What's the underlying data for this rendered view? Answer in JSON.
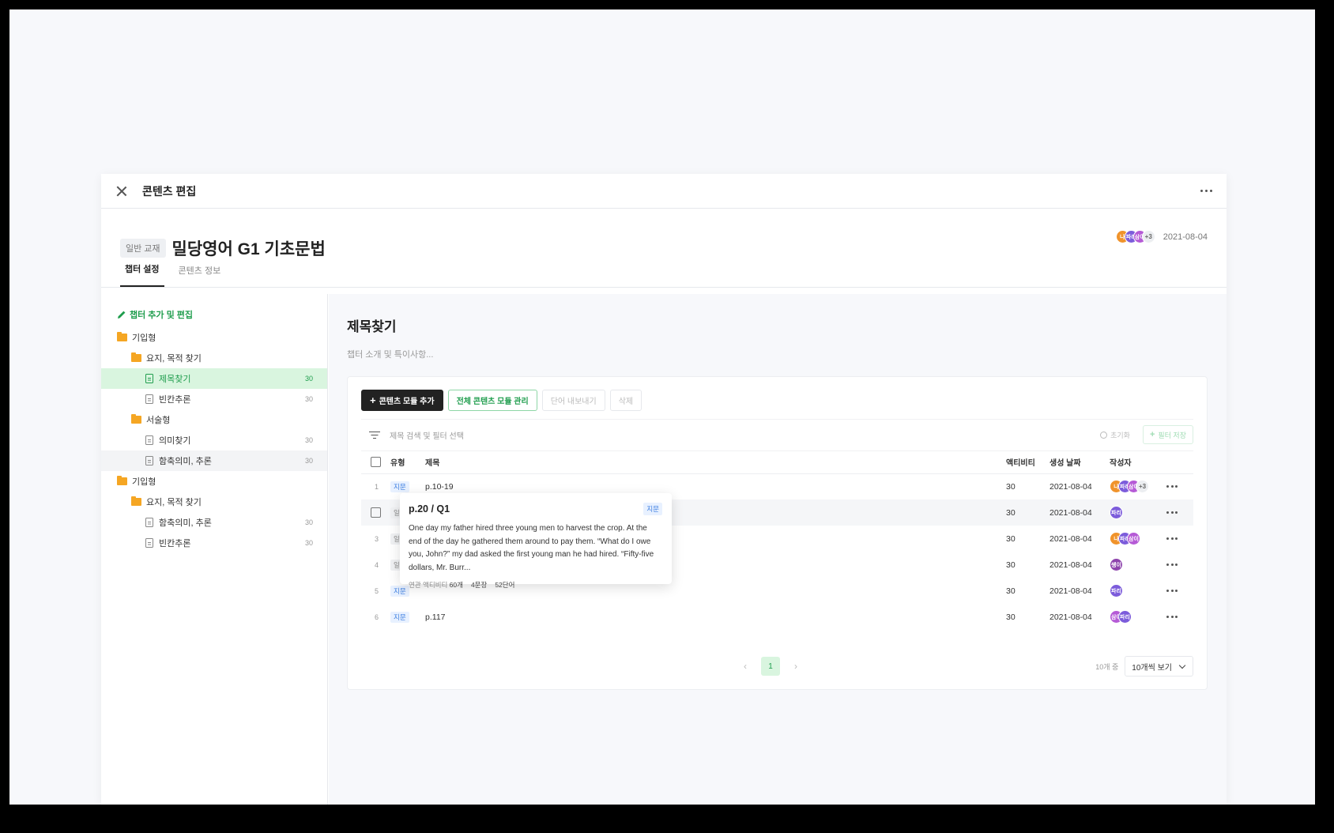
{
  "topbar": {
    "title": "콘텐츠 편집"
  },
  "book": {
    "badge": "일반 교재",
    "title": "밀당영어 G1 기초문법",
    "date": "2021-08-04"
  },
  "header_avatars": [
    {
      "label": "나",
      "color": "#f0932b"
    },
    {
      "label": "파리",
      "color": "#7c5cdb"
    },
    {
      "label": "삼이",
      "color": "#b55ad6"
    },
    {
      "label": "+3",
      "color": "#eceef1"
    }
  ],
  "tabs": [
    {
      "label": "챕터 설정",
      "active": true
    },
    {
      "label": "콘텐츠 정보",
      "active": false
    }
  ],
  "sidebar": {
    "add_label": "챕터 추가 및 편집",
    "tree": [
      {
        "label": "기입형",
        "kind": "folder",
        "level": 0
      },
      {
        "label": "요지, 목적 찾기",
        "kind": "folder",
        "level": 1
      },
      {
        "label": "제목찾기",
        "kind": "doc",
        "level": 2,
        "count": "30",
        "state": "active"
      },
      {
        "label": "빈칸추론",
        "kind": "doc",
        "level": 2,
        "count": "30"
      },
      {
        "label": "서술형",
        "kind": "folder",
        "level": 1
      },
      {
        "label": "의미찾기",
        "kind": "doc",
        "level": 2,
        "count": "30"
      },
      {
        "label": "함축의미, 추론",
        "kind": "doc",
        "level": 2,
        "count": "30",
        "state": "hover"
      },
      {
        "label": "기입형",
        "kind": "folder",
        "level": 0
      },
      {
        "label": "요지, 목적 찾기",
        "kind": "folder",
        "level": 1
      },
      {
        "label": "함축의미, 추론",
        "kind": "doc",
        "level": 2,
        "count": "30"
      },
      {
        "label": "빈칸추론",
        "kind": "doc",
        "level": 2,
        "count": "30"
      }
    ]
  },
  "main": {
    "chapter_title": "제목찾기",
    "chapter_desc_placeholder": "챕터 소개 및 특이사항...",
    "toolbar": {
      "add_module": "콘텐츠 모듈 추가",
      "manage_all": "전체 콘텐츠 모듈 관리",
      "export_words": "단어 내보내기",
      "delete": "삭제"
    },
    "filter": {
      "placeholder": "제목 검색 및 필터 선택",
      "reset": "초기화",
      "save": "필터 저장"
    },
    "columns": {
      "type": "유형",
      "title": "제목",
      "activity": "액티비티",
      "created": "생성 날짜",
      "author": "작성자"
    },
    "rows": [
      {
        "idx": "1",
        "type": "지문",
        "type_color": "blue",
        "title": "p.10-19",
        "activity": "30",
        "date": "2021-08-04",
        "avatars": [
          {
            "label": "나",
            "color": "#f0932b"
          },
          {
            "label": "파리",
            "color": "#7c5cdb"
          },
          {
            "label": "삼이",
            "color": "#b55ad6"
          },
          {
            "label": "+3",
            "color": "#eceef1"
          }
        ]
      },
      {
        "idx": "",
        "type": "일반",
        "type_color": "gray",
        "title": "p.20 / Q1",
        "activity": "30",
        "date": "2021-08-04",
        "checkbox": true,
        "highlight": true,
        "avatars": [
          {
            "label": "파리",
            "color": "#7c5cdb"
          }
        ]
      },
      {
        "idx": "3",
        "type": "일반",
        "type_color": "gray",
        "title": "",
        "activity": "30",
        "date": "2021-08-04",
        "avatars": [
          {
            "label": "나",
            "color": "#f0932b"
          },
          {
            "label": "파리",
            "color": "#7c5cdb"
          },
          {
            "label": "삼이",
            "color": "#b55ad6"
          }
        ]
      },
      {
        "idx": "4",
        "type": "일반",
        "type_color": "gray",
        "title": "",
        "activity": "30",
        "date": "2021-08-04",
        "avatars": [
          {
            "label": "쌩이",
            "color": "#8e44ad"
          }
        ]
      },
      {
        "idx": "5",
        "type": "지문",
        "type_color": "blue",
        "title": "",
        "activity": "30",
        "date": "2021-08-04",
        "avatars": [
          {
            "label": "파리",
            "color": "#7c5cdb"
          }
        ]
      },
      {
        "idx": "6",
        "type": "지문",
        "type_color": "blue",
        "title": "p.117",
        "activity": "30",
        "date": "2021-08-04",
        "avatars": [
          {
            "label": "삼이",
            "color": "#b55ad6"
          },
          {
            "label": "파리",
            "color": "#7c5cdb"
          }
        ]
      }
    ],
    "pagination": {
      "current": "1",
      "total_label": "10개 중",
      "per_page": "10개씩 보기"
    }
  },
  "tooltip": {
    "title": "p.20 / Q1",
    "badge": "지문",
    "body": "One day my father hired three young men to harvest the crop. At the end of the day he gathered them around to pay them. “What do I owe you, John?” my dad asked the first young man he had hired. “Fifty-five dollars, Mr. Burr...",
    "meta_activity_label": "연관 액티비티",
    "meta_activity_value": "60개",
    "meta_sentences": "4문장",
    "meta_words": "52단어"
  }
}
